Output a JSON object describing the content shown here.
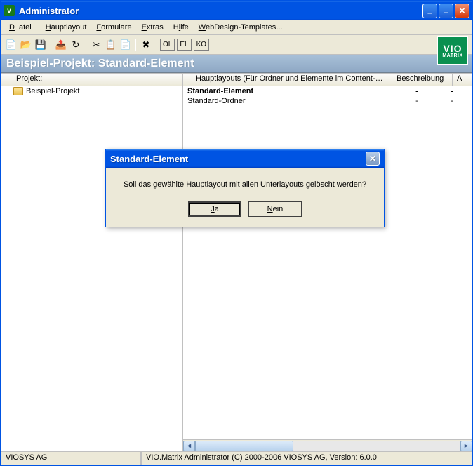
{
  "window": {
    "title": "Administrator"
  },
  "menu": {
    "items": [
      "Datei",
      "Hauptlayout",
      "Formulare",
      "Extras",
      "Hilfe",
      "WebDesign-Templates..."
    ]
  },
  "toolbar": {
    "labels": {
      "ol": "OL",
      "el": "EL",
      "ko": "KO"
    }
  },
  "logo": {
    "line1": "VIO",
    "line2": "MATRIX"
  },
  "header": "Beispiel-Projekt: Standard-Element",
  "left_pane": {
    "header": "Projekt:",
    "tree": [
      {
        "label": "Beispiel-Projekt"
      }
    ]
  },
  "right_pane": {
    "columns": [
      "Hauptlayouts (Für Ordner und Elemente im Content-Mana...",
      "Beschreibung",
      "A"
    ],
    "rows": [
      {
        "name": "Standard-Element",
        "c2": "-",
        "c3": "-",
        "bold": true
      },
      {
        "name": "Standard-Ordner",
        "c2": "-",
        "c3": "-",
        "bold": false
      }
    ]
  },
  "dialog": {
    "title": "Standard-Element",
    "message": "Soll das gewählte Hauptlayout mit allen Unterlayouts gelöscht werden?",
    "yes": "Ja",
    "no": "Nein"
  },
  "status": {
    "left": "VIOSYS AG",
    "right": "VIO.Matrix Administrator (C) 2000-2006 VIOSYS AG, Version: 6.0.0"
  }
}
